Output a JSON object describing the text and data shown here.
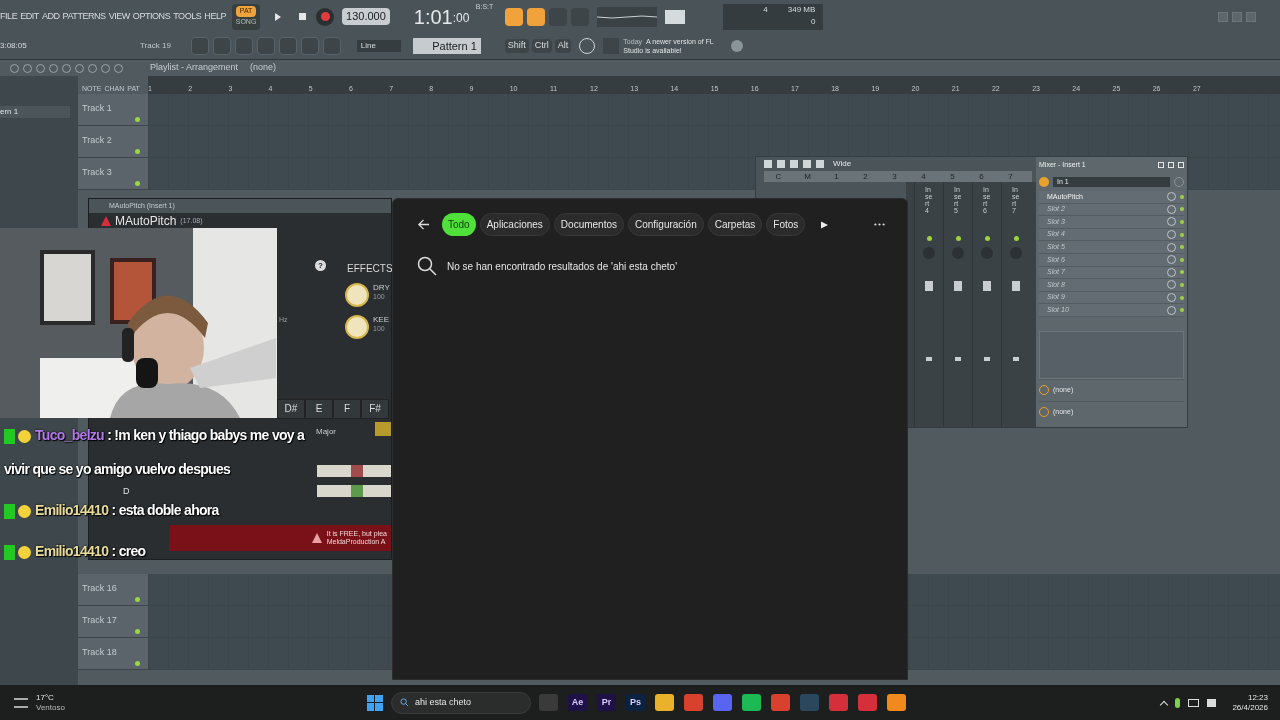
{
  "menu": [
    "FILE",
    "EDIT",
    "ADD",
    "PATTERNS",
    "VIEW",
    "OPTIONS",
    "TOOLS",
    "HELP"
  ],
  "modes": [
    {
      "label": "PAT",
      "selected": true
    },
    {
      "label": "SONG",
      "selected": false
    }
  ],
  "tempo": "130.000",
  "time": "1:01",
  "time_sub": ":00",
  "time_unit": "B:S:T",
  "perf": {
    "cpu": "4",
    "memory": "349 MB",
    "polyphony": "0"
  },
  "hint": {
    "time": "3:08:05",
    "track": "Track 19"
  },
  "snap": "Line",
  "pattern": "Pattern 1",
  "keys": [
    "Shift",
    "Ctrl",
    "Alt"
  ],
  "news": {
    "day": "Today",
    "text": "A newer version of FL Studio is available!"
  },
  "playlist": {
    "title": "Playlist - Arrangement",
    "pattern": "(none)",
    "pattern_item": "ern 1",
    "tabs": [
      "NOTE",
      "CHAN",
      "PAT"
    ],
    "ruler": [
      "1",
      "2",
      "3",
      "4",
      "5",
      "6",
      "7",
      "8",
      "9",
      "10",
      "11",
      "12",
      "13",
      "14",
      "15",
      "16",
      "17",
      "18",
      "19",
      "20",
      "21",
      "22",
      "23",
      "24",
      "25",
      "26",
      "27"
    ],
    "tracks_top": [
      "Track 1",
      "Track 2",
      "Track 3"
    ],
    "tracks_bottom": [
      "Track 16",
      "Track 17",
      "Track 18"
    ]
  },
  "plugin": {
    "title": "MAutoPitch (Insert 1)",
    "name": "MAutoPitch",
    "version": "(17.08)",
    "help": "?",
    "effects": "EFFECTS",
    "knobs": [
      {
        "label": "DRY",
        "value": "100"
      },
      {
        "label": "KEE",
        "value": "100"
      }
    ],
    "unit": "Hz",
    "notes": [
      "D#",
      "E",
      "F",
      "F#"
    ],
    "scale": "Major",
    "key": "D",
    "banner": "It is FREE, but plea",
    "banner_sub": "MeldaProduction A"
  },
  "chat": [
    {
      "user": "Tuco_belzu",
      "color": "#b37ae8",
      "separator": ":",
      "text": "!m ken y thiago babys me voy a vivir que se yo amigo vuelvo despues"
    },
    {
      "user": "Emilio14410",
      "color": "#e9dc9a",
      "separator": ":",
      "text": "esta doble ahora"
    },
    {
      "user": "Emilio14410",
      "color": "#e9dc9a",
      "separator": ":",
      "text": "creo"
    }
  ],
  "search_panel": {
    "tabs": [
      {
        "label": "Todo",
        "selected": true
      },
      {
        "label": "Aplicaciones",
        "selected": false
      },
      {
        "label": "Documentos",
        "selected": false
      },
      {
        "label": "Configuración",
        "selected": false
      },
      {
        "label": "Carpetas",
        "selected": false
      },
      {
        "label": "Fotos",
        "selected": false
      }
    ],
    "message": "No se han encontrado resultados de 'ahi esta cheto'"
  },
  "mixer": {
    "title": "Mixer - Insert 1",
    "preset": "Wide",
    "header": [
      "C",
      "M",
      "1",
      "2",
      "3",
      "4",
      "5",
      "6",
      "7"
    ],
    "inserts": [
      "Insert 4",
      "Insert 5",
      "Insert 6",
      "Insert 7"
    ],
    "input": "In 1",
    "slots": [
      {
        "label": "MAutoPitch",
        "loaded": true
      },
      {
        "label": "Slot 2",
        "loaded": false
      },
      {
        "label": "Slot 3",
        "loaded": false
      },
      {
        "label": "Slot 4",
        "loaded": false
      },
      {
        "label": "Slot 5",
        "loaded": false
      },
      {
        "label": "Slot 6",
        "loaded": false
      },
      {
        "label": "Slot 7",
        "loaded": false
      },
      {
        "label": "Slot 8",
        "loaded": false
      },
      {
        "label": "Slot 9",
        "loaded": false
      },
      {
        "label": "Slot 10",
        "loaded": false
      }
    ],
    "outputs": [
      "(none)",
      "(none)"
    ]
  },
  "taskbar": {
    "temperature": "17°C",
    "weather": "Ventoso",
    "search": "ahi esta cheto",
    "apps": [
      {
        "color": "#3a3a3a"
      },
      {
        "label": "Ae",
        "color": "#1f1147"
      },
      {
        "label": "Pr",
        "color": "#1f1147"
      },
      {
        "label": "Ps",
        "color": "#0b2340"
      },
      {
        "color": "#e9b22a"
      },
      {
        "color": "#d9412f"
      },
      {
        "color": "#5865f2"
      },
      {
        "color": "#1db954"
      },
      {
        "color": "#d9412f"
      },
      {
        "color": "#2a475e"
      },
      {
        "color": "#d42f3a"
      },
      {
        "color": "#d42f3a"
      },
      {
        "color": "#f08a1d"
      }
    ],
    "time": "12:23",
    "date": "26/4/2026"
  }
}
